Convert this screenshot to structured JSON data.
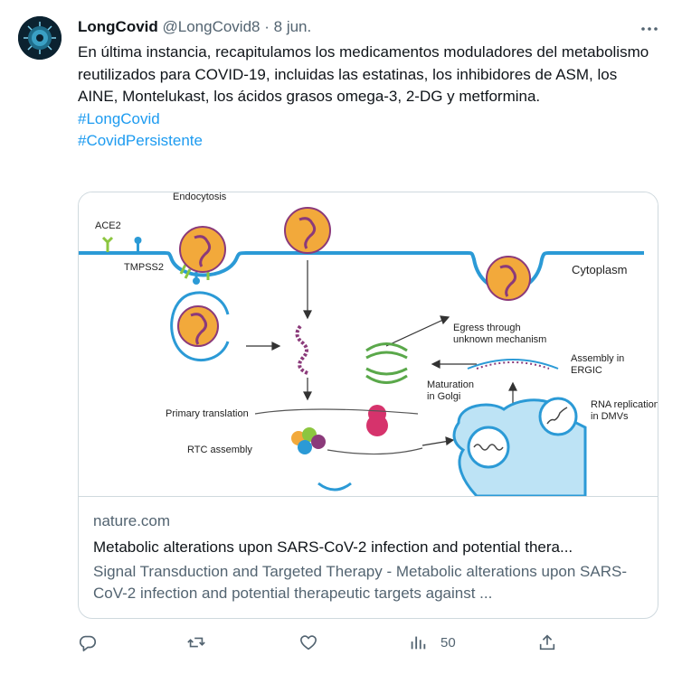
{
  "author": {
    "name": "LongCovid",
    "handle": "@LongCovid8",
    "separator": "·",
    "date": "8 jun.",
    "avatar_icon": "virus-avatar-icon"
  },
  "tweet": {
    "text": "En última instancia, recapitulamos los medicamentos moduladores del metabolismo reutilizados para COVID-19, incluidas las estatinas, los inhibidores de ASM, los AINE, Montelukast, los ácidos grasos omega-3, 2-DG y metformina.",
    "hashtags": [
      "#LongCovid",
      "#CovidPersistente"
    ]
  },
  "card": {
    "domain": "nature.com",
    "title": "Metabolic alterations upon SARS-CoV-2 infection and potential thera...",
    "description": "Signal Transduction and Targeted Therapy - Metabolic alterations upon SARS-CoV-2 infection and potential therapeutic targets against ...",
    "image": {
      "labels": {
        "endocytosis": "Endocytosis",
        "ace2": "ACE2",
        "tmpss2": "TMPSS2",
        "cytoplasm": "Cytoplasm",
        "egress": "Egress through",
        "egress2": "unknown mechanism",
        "assembly": "Assembly in",
        "assembly2": "ERGIC",
        "maturation": "Maturation",
        "maturation2": "in Golgi",
        "primary": "Primary translation",
        "rtc": "RTC assembly",
        "rna": "RNA replication",
        "rna2": "in DMVs"
      }
    }
  },
  "actions": {
    "reply_icon": "reply-icon",
    "retweet_icon": "retweet-icon",
    "like_icon": "like-icon",
    "views_icon": "views-icon",
    "views_count": "50",
    "share_icon": "share-icon"
  },
  "colors": {
    "link": "#1d9bf0",
    "secondary_text": "#536471",
    "membrane": "#2b9ad6",
    "virus_fill": "#f2a93b",
    "rna": "#8b3a7a"
  }
}
